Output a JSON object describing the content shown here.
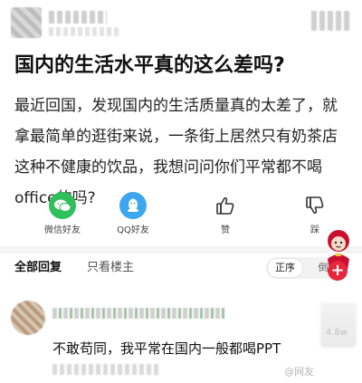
{
  "post": {
    "title": "国内的生活水平真的这么差吗?",
    "body": "最近回国，发现国内的生活质量真的太差了，就拿最简单的逛街来说，一条街上居然只有奶茶店这种不健康的饮品，我想问问你们平常都不喝office的吗?"
  },
  "share": {
    "wechat_label": "微信好友",
    "qq_label": "QQ好友",
    "like_label": "赞",
    "dislike_label": "踩"
  },
  "tabs": {
    "all_label": "全部回复",
    "op_only_label": "只看楼主"
  },
  "sort": {
    "ascending_label": "正序",
    "other_label": "倒"
  },
  "fab": {
    "label": "+"
  },
  "comment": {
    "text": "不敢苟同，我平常在国内一般都喝PPT",
    "like_count": "4.8w"
  },
  "watermark": {
    "text": "@网友"
  },
  "colors": {
    "wechat_green": "#2fbf5b",
    "qq_blue": "#3da6f0",
    "fab_red": "#e5263c"
  },
  "icons": [
    "wechat-icon",
    "qq-icon",
    "thumbs-up-icon",
    "thumbs-down-icon"
  ]
}
